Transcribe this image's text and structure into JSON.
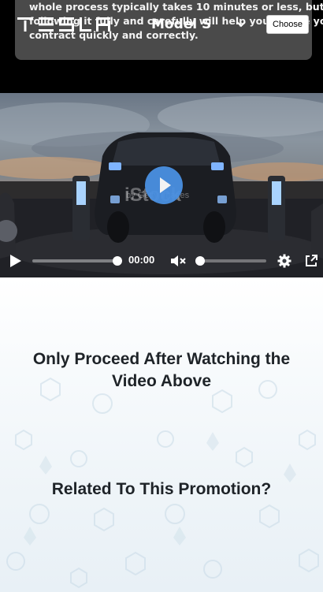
{
  "top_card": {
    "line1": "whole process typically takes 10 minutes or less, but",
    "line2": "following it fully and carefully will help you secure your",
    "line3": "contract quickly and correctly."
  },
  "header": {
    "brand": "TESLA",
    "model_selected": "Model S",
    "choose_label": "Choose"
  },
  "video": {
    "watermark": "iStock",
    "watermark_sub": "by Getty Images",
    "time": "00:00",
    "progress": 0.0
  },
  "content": {
    "heading_watch": "Only Proceed After Watching the Video Above",
    "heading_related": "Related To This Promotion?"
  },
  "icons": [
    "tesla-logo",
    "chevron-down-icon",
    "play-icon",
    "mute-icon",
    "settings-gear-icon",
    "popout-icon"
  ]
}
